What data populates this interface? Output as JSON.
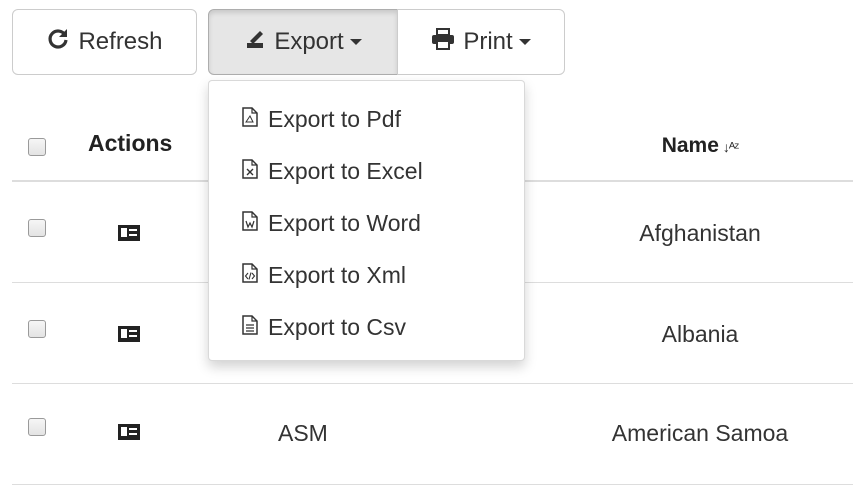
{
  "toolbar": {
    "refresh_label": "Refresh",
    "export_label": "Export",
    "print_label": "Print"
  },
  "export_menu": {
    "items": [
      {
        "label": "Export to Pdf",
        "icon": "pdf-file-icon"
      },
      {
        "label": "Export to Excel",
        "icon": "excel-file-icon"
      },
      {
        "label": "Export to Word",
        "icon": "word-file-icon"
      },
      {
        "label": "Export to Xml",
        "icon": "xml-file-icon"
      },
      {
        "label": "Export to Csv",
        "icon": "csv-file-icon"
      }
    ]
  },
  "table": {
    "headers": {
      "actions": "Actions",
      "name": "Name",
      "name_sort_icon": "sort-alpha-asc-icon"
    },
    "rows": [
      {
        "code": "",
        "name": "Afghanistan",
        "action_icon": "id-card-icon"
      },
      {
        "code": "",
        "name": "Albania",
        "action_icon": "id-card-icon"
      },
      {
        "code": "ASM",
        "name": "American Samoa",
        "action_icon": "id-card-icon"
      }
    ]
  }
}
